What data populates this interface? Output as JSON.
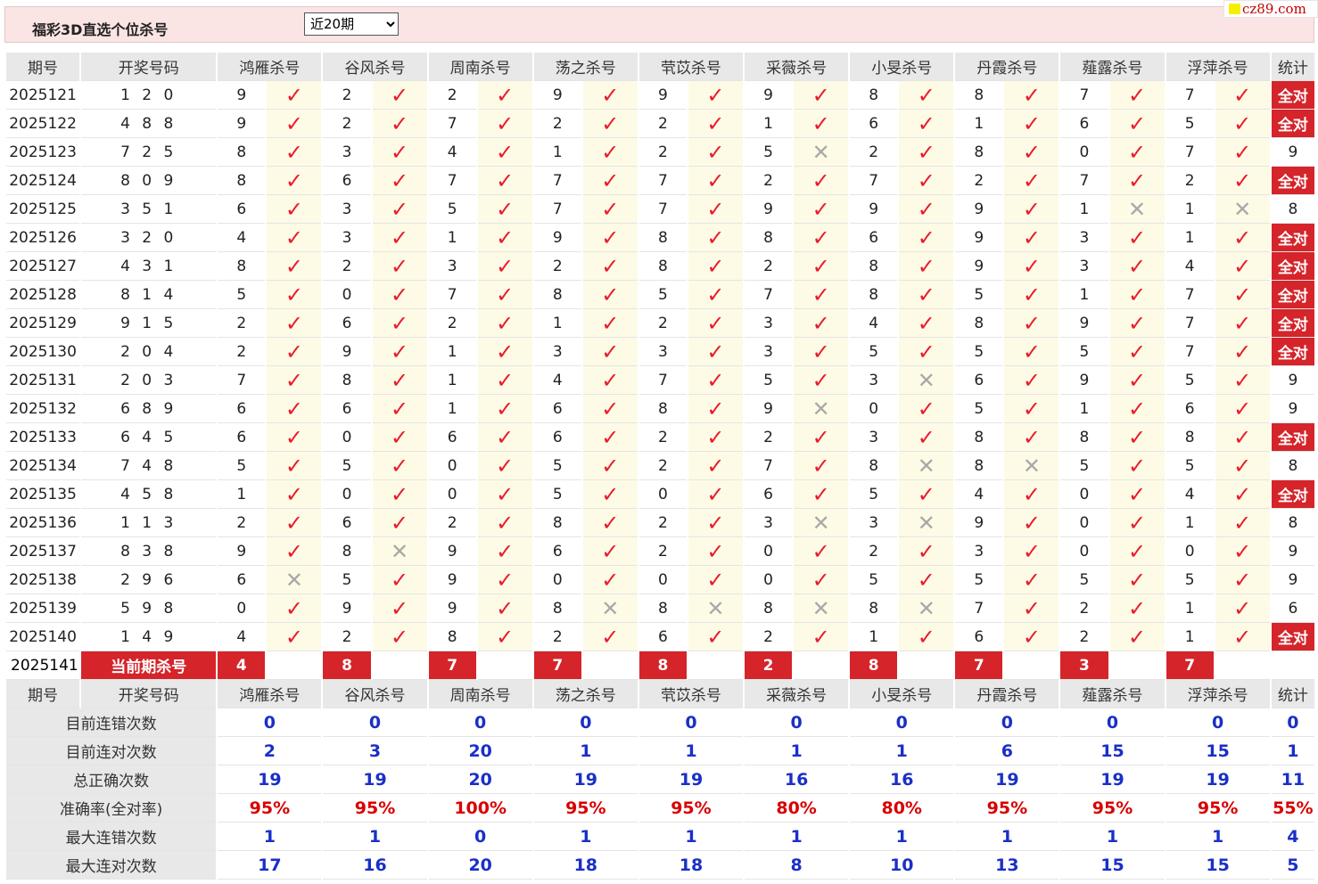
{
  "header": {
    "title": "福彩3D直选个位杀号",
    "period_options": [
      "近20期"
    ],
    "period_selected": "近20期"
  },
  "site_badge": "cz89.com",
  "columns": {
    "period": "期号",
    "draw": "开奖号码",
    "stat": "统计",
    "experts": [
      "鸿雁杀号",
      "谷风杀号",
      "周南杀号",
      "荡之杀号",
      "茕苡杀号",
      "采薇杀号",
      "小旻杀号",
      "丹霞杀号",
      "薤露杀号",
      "浮萍杀号"
    ]
  },
  "rows": [
    {
      "period": "2025121",
      "draw": "1 2 0",
      "kills": [
        "9",
        "2",
        "2",
        "9",
        "9",
        "9",
        "8",
        "8",
        "7",
        "7"
      ],
      "hits": [
        1,
        1,
        1,
        1,
        1,
        1,
        1,
        1,
        1,
        1
      ],
      "stat": "全对"
    },
    {
      "period": "2025122",
      "draw": "4 8 8",
      "kills": [
        "9",
        "2",
        "7",
        "2",
        "2",
        "1",
        "6",
        "1",
        "6",
        "5"
      ],
      "hits": [
        1,
        1,
        1,
        1,
        1,
        1,
        1,
        1,
        1,
        1
      ],
      "stat": "全对"
    },
    {
      "period": "2025123",
      "draw": "7 2 5",
      "kills": [
        "8",
        "3",
        "4",
        "1",
        "2",
        "5",
        "2",
        "8",
        "0",
        "7"
      ],
      "hits": [
        1,
        1,
        1,
        1,
        1,
        0,
        1,
        1,
        1,
        1
      ],
      "stat": "9"
    },
    {
      "period": "2025124",
      "draw": "8 0 9",
      "kills": [
        "8",
        "6",
        "7",
        "7",
        "7",
        "2",
        "7",
        "2",
        "7",
        "2"
      ],
      "hits": [
        1,
        1,
        1,
        1,
        1,
        1,
        1,
        1,
        1,
        1
      ],
      "stat": "全对"
    },
    {
      "period": "2025125",
      "draw": "3 5 1",
      "kills": [
        "6",
        "3",
        "5",
        "7",
        "7",
        "9",
        "9",
        "9",
        "1",
        "1"
      ],
      "hits": [
        1,
        1,
        1,
        1,
        1,
        1,
        1,
        1,
        0,
        0
      ],
      "stat": "8"
    },
    {
      "period": "2025126",
      "draw": "3 2 0",
      "kills": [
        "4",
        "3",
        "1",
        "9",
        "8",
        "8",
        "6",
        "9",
        "3",
        "1"
      ],
      "hits": [
        1,
        1,
        1,
        1,
        1,
        1,
        1,
        1,
        1,
        1
      ],
      "stat": "全对"
    },
    {
      "period": "2025127",
      "draw": "4 3 1",
      "kills": [
        "8",
        "2",
        "3",
        "2",
        "8",
        "2",
        "8",
        "9",
        "3",
        "4"
      ],
      "hits": [
        1,
        1,
        1,
        1,
        1,
        1,
        1,
        1,
        1,
        1
      ],
      "stat": "全对"
    },
    {
      "period": "2025128",
      "draw": "8 1 4",
      "kills": [
        "5",
        "0",
        "7",
        "8",
        "5",
        "7",
        "8",
        "5",
        "1",
        "7"
      ],
      "hits": [
        1,
        1,
        1,
        1,
        1,
        1,
        1,
        1,
        1,
        1
      ],
      "stat": "全对"
    },
    {
      "period": "2025129",
      "draw": "9 1 5",
      "kills": [
        "2",
        "6",
        "2",
        "1",
        "2",
        "3",
        "4",
        "8",
        "9",
        "7"
      ],
      "hits": [
        1,
        1,
        1,
        1,
        1,
        1,
        1,
        1,
        1,
        1
      ],
      "stat": "全对"
    },
    {
      "period": "2025130",
      "draw": "2 0 4",
      "kills": [
        "2",
        "9",
        "1",
        "3",
        "3",
        "3",
        "5",
        "5",
        "5",
        "7"
      ],
      "hits": [
        1,
        1,
        1,
        1,
        1,
        1,
        1,
        1,
        1,
        1
      ],
      "stat": "全对"
    },
    {
      "period": "2025131",
      "draw": "2 0 3",
      "kills": [
        "7",
        "8",
        "1",
        "4",
        "7",
        "5",
        "3",
        "6",
        "9",
        "5"
      ],
      "hits": [
        1,
        1,
        1,
        1,
        1,
        1,
        0,
        1,
        1,
        1
      ],
      "stat": "9"
    },
    {
      "period": "2025132",
      "draw": "6 8 9",
      "kills": [
        "6",
        "6",
        "1",
        "6",
        "8",
        "9",
        "0",
        "5",
        "1",
        "6"
      ],
      "hits": [
        1,
        1,
        1,
        1,
        1,
        0,
        1,
        1,
        1,
        1
      ],
      "stat": "9"
    },
    {
      "period": "2025133",
      "draw": "6 4 5",
      "kills": [
        "6",
        "0",
        "6",
        "6",
        "2",
        "2",
        "3",
        "8",
        "8",
        "8"
      ],
      "hits": [
        1,
        1,
        1,
        1,
        1,
        1,
        1,
        1,
        1,
        1
      ],
      "stat": "全对"
    },
    {
      "period": "2025134",
      "draw": "7 4 8",
      "kills": [
        "5",
        "5",
        "0",
        "5",
        "2",
        "7",
        "8",
        "8",
        "5",
        "5"
      ],
      "hits": [
        1,
        1,
        1,
        1,
        1,
        1,
        0,
        0,
        1,
        1
      ],
      "stat": "8"
    },
    {
      "period": "2025135",
      "draw": "4 5 8",
      "kills": [
        "1",
        "0",
        "0",
        "5",
        "0",
        "6",
        "5",
        "4",
        "0",
        "4"
      ],
      "hits": [
        1,
        1,
        1,
        1,
        1,
        1,
        1,
        1,
        1,
        1
      ],
      "stat": "全对"
    },
    {
      "period": "2025136",
      "draw": "1 1 3",
      "kills": [
        "2",
        "6",
        "2",
        "8",
        "2",
        "3",
        "3",
        "9",
        "0",
        "1"
      ],
      "hits": [
        1,
        1,
        1,
        1,
        1,
        0,
        0,
        1,
        1,
        1
      ],
      "stat": "8"
    },
    {
      "period": "2025137",
      "draw": "8 3 8",
      "kills": [
        "9",
        "8",
        "9",
        "6",
        "2",
        "0",
        "2",
        "3",
        "0",
        "0"
      ],
      "hits": [
        1,
        0,
        1,
        1,
        1,
        1,
        1,
        1,
        1,
        1
      ],
      "stat": "9"
    },
    {
      "period": "2025138",
      "draw": "2 9 6",
      "kills": [
        "6",
        "5",
        "9",
        "0",
        "0",
        "0",
        "5",
        "5",
        "5",
        "5"
      ],
      "hits": [
        0,
        1,
        1,
        1,
        1,
        1,
        1,
        1,
        1,
        1
      ],
      "stat": "9"
    },
    {
      "period": "2025139",
      "draw": "5 9 8",
      "kills": [
        "0",
        "9",
        "9",
        "8",
        "8",
        "8",
        "8",
        "7",
        "2",
        "1"
      ],
      "hits": [
        1,
        1,
        1,
        0,
        0,
        0,
        0,
        1,
        1,
        1
      ],
      "stat": "6"
    },
    {
      "period": "2025140",
      "draw": "1 4 9",
      "kills": [
        "4",
        "2",
        "8",
        "2",
        "6",
        "2",
        "1",
        "6",
        "2",
        "1"
      ],
      "hits": [
        1,
        1,
        1,
        1,
        1,
        1,
        1,
        1,
        1,
        1
      ],
      "stat": "全对"
    }
  ],
  "current": {
    "period": "2025141",
    "label": "当前期杀号",
    "kills": [
      "4",
      "8",
      "7",
      "7",
      "8",
      "2",
      "8",
      "7",
      "3",
      "7"
    ]
  },
  "summary": [
    {
      "label": "目前连错次数",
      "values": [
        "0",
        "0",
        "0",
        "0",
        "0",
        "0",
        "0",
        "0",
        "0",
        "0"
      ],
      "stat": "0"
    },
    {
      "label": "目前连对次数",
      "values": [
        "2",
        "3",
        "20",
        "1",
        "1",
        "1",
        "1",
        "6",
        "15",
        "15"
      ],
      "stat": "1"
    },
    {
      "label": "总正确次数",
      "values": [
        "19",
        "19",
        "20",
        "19",
        "19",
        "16",
        "16",
        "19",
        "19",
        "19"
      ],
      "stat": "11"
    },
    {
      "label": "准确率(全对率)",
      "values": [
        "95%",
        "95%",
        "100%",
        "95%",
        "95%",
        "80%",
        "80%",
        "95%",
        "95%",
        "95%"
      ],
      "stat": "55%",
      "is_rate": true
    },
    {
      "label": "最大连错次数",
      "values": [
        "1",
        "1",
        "0",
        "1",
        "1",
        "1",
        "1",
        "1",
        "1",
        "1"
      ],
      "stat": "4"
    },
    {
      "label": "最大连对次数",
      "values": [
        "17",
        "16",
        "20",
        "18",
        "18",
        "8",
        "10",
        "13",
        "15",
        "15"
      ],
      "stat": "5"
    }
  ],
  "icons": {
    "hit": "check-icon",
    "miss": "cross-icon"
  },
  "colors": {
    "accent": "#d5242a",
    "hit": "#ea1b2d",
    "miss": "#a8a8a8",
    "stat_blue": "#1a2fc8",
    "rate_red": "#d90000",
    "header_bg": "#fbe4e4"
  }
}
